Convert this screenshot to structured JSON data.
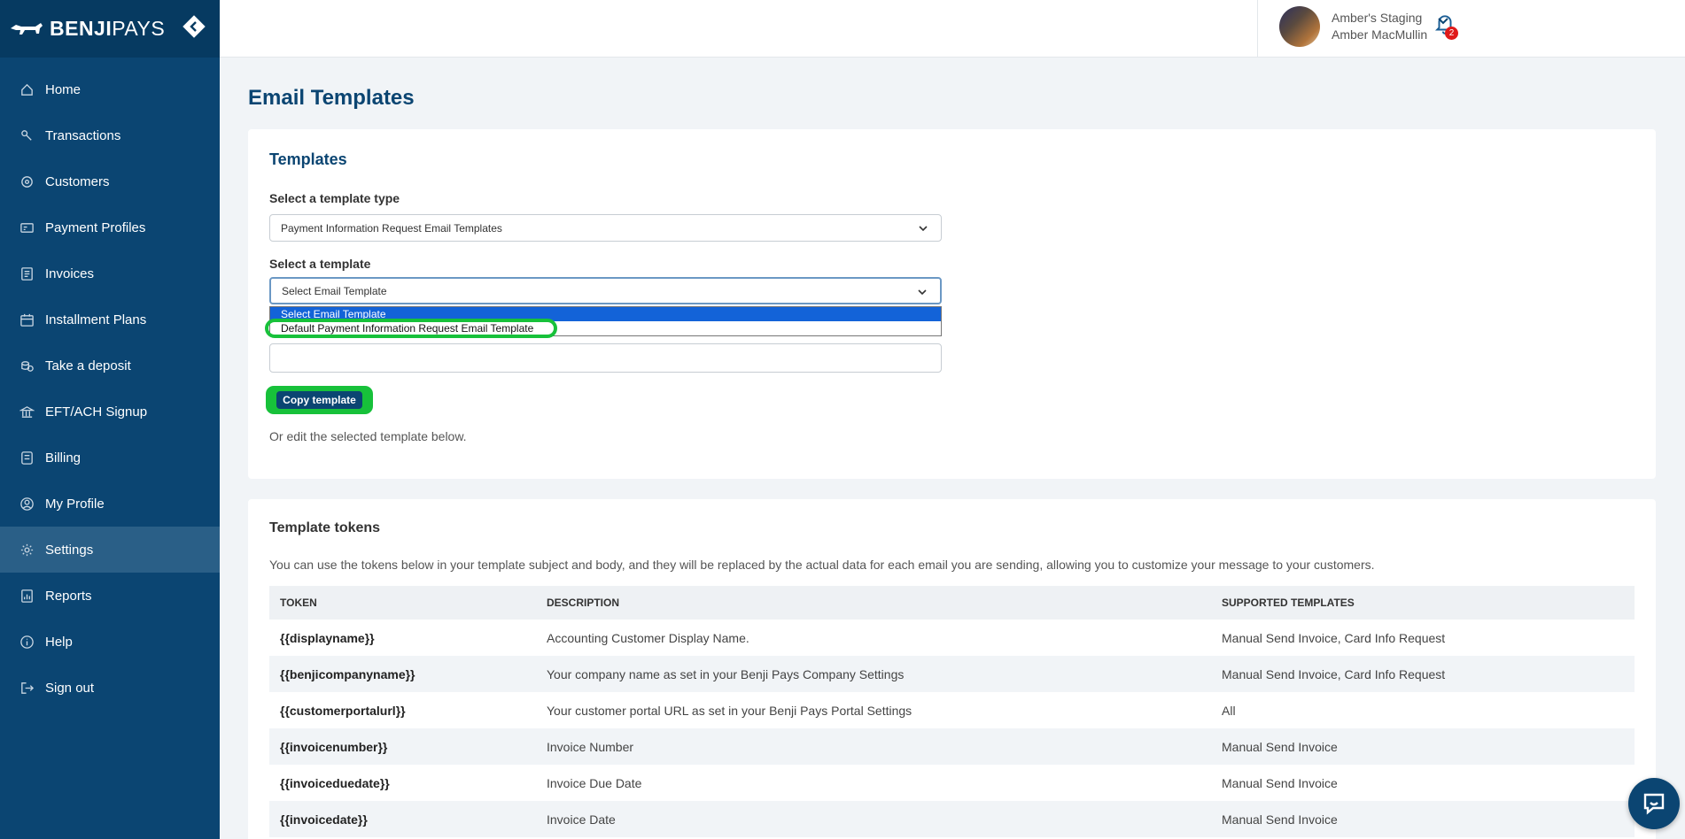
{
  "brand": {
    "name_bold": "BENJI",
    "name_light": "PAYS"
  },
  "sidebar": {
    "items": [
      {
        "label": "Home",
        "icon": "home-icon",
        "active": false
      },
      {
        "label": "Transactions",
        "icon": "transactions-icon",
        "active": false
      },
      {
        "label": "Customers",
        "icon": "customers-icon",
        "active": false
      },
      {
        "label": "Payment Profiles",
        "icon": "payment-profiles-icon",
        "active": false
      },
      {
        "label": "Invoices",
        "icon": "invoices-icon",
        "active": false
      },
      {
        "label": "Installment Plans",
        "icon": "calendar-icon",
        "active": false
      },
      {
        "label": "Take a deposit",
        "icon": "coins-icon",
        "active": false
      },
      {
        "label": "EFT/ACH Signup",
        "icon": "bank-icon",
        "active": false
      },
      {
        "label": "Billing",
        "icon": "billing-icon",
        "active": false
      },
      {
        "label": "My Profile",
        "icon": "user-circle-icon",
        "active": false
      },
      {
        "label": "Settings",
        "icon": "gear-icon",
        "active": true
      },
      {
        "label": "Reports",
        "icon": "reports-icon",
        "active": false
      },
      {
        "label": "Help",
        "icon": "info-icon",
        "active": false
      },
      {
        "label": "Sign out",
        "icon": "sign-out-icon",
        "active": false
      }
    ]
  },
  "header": {
    "notification_count": "2",
    "company_name": "Amber's Staging",
    "user_name": "Amber MacMullin"
  },
  "page": {
    "title": "Email Templates"
  },
  "templates_card": {
    "title": "Templates",
    "type_label": "Select a template type",
    "type_value": "Payment Information Request Email Templates",
    "template_label": "Select a template",
    "template_value": "Select Email Template",
    "template_options": [
      "Select Email Template",
      "Default Payment Information Request Email Template"
    ],
    "copy_button": "Copy template",
    "hint": "Or edit the selected template below."
  },
  "tokens_card": {
    "title": "Template tokens",
    "description": "You can use the tokens below in your template subject and body, and they will be replaced by the actual data for each email you are sending, allowing you to customize your message to your customers.",
    "columns": [
      "TOKEN",
      "DESCRIPTION",
      "SUPPORTED TEMPLATES"
    ],
    "rows": [
      [
        "{{displayname}}",
        "Accounting Customer Display Name.",
        "Manual Send Invoice, Card Info Request"
      ],
      [
        "{{benjicompanyname}}",
        "Your company name as set in your Benji Pays Company Settings",
        "Manual Send Invoice, Card Info Request"
      ],
      [
        "{{customerportalurl}}",
        "Your customer portal URL as set in your Benji Pays Portal Settings",
        "All"
      ],
      [
        "{{invoicenumber}}",
        "Invoice Number",
        "Manual Send Invoice"
      ],
      [
        "{{invoiceduedate}}",
        "Invoice Due Date",
        "Manual Send Invoice"
      ],
      [
        "{{invoicedate}}",
        "Invoice Date",
        "Manual Send Invoice"
      ]
    ]
  },
  "colors": {
    "sidebar": "#0b4572",
    "accent": "#0b4572",
    "highlight": "#17c13a",
    "badge": "#e01a1a"
  }
}
